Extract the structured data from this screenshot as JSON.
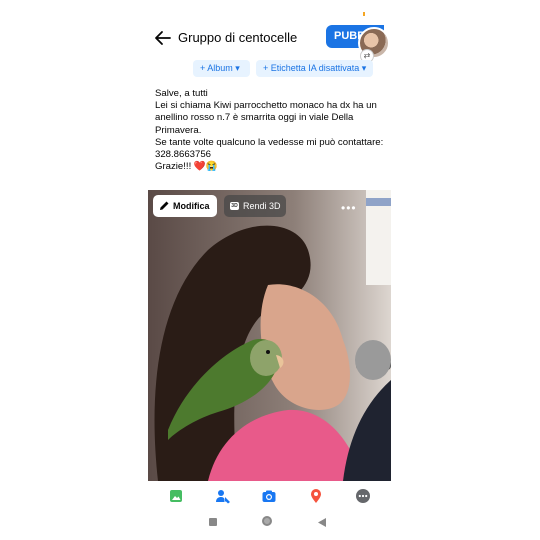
{
  "header": {
    "title": "Gruppo di centocelle",
    "publish_label": "PUBBLICA"
  },
  "chips": [
    {
      "label": "+ Album ▾"
    },
    {
      "label": "+ Etichetta IA disattivata ▾"
    }
  ],
  "post": {
    "lines": [
      "Salve, a tutti",
      "Lei si chiama Kiwi parrocchetto monaco ha dx ha un anellino rosso n.7  è smarrita oggi in viale Della Primavera.",
      "Se tante volte qualcuno la vedesse mi può contattare: 328.8663756",
      "Grazie!!! ❤️😭"
    ]
  },
  "photo": {
    "edit_label": "Modifica",
    "render3d_label": "Rendi 3D",
    "render3d_badge": "3D",
    "more_label": "•••"
  },
  "toolbar": {
    "icons": [
      "photo-icon",
      "tag-people-icon",
      "camera-icon",
      "location-icon",
      "more-icon"
    ],
    "colors": {
      "photo": "#45bd62",
      "tag": "#1877f2",
      "camera": "#1877f2",
      "location": "#f5533d",
      "more": "#65676b"
    }
  },
  "accent": "#1b74e4"
}
